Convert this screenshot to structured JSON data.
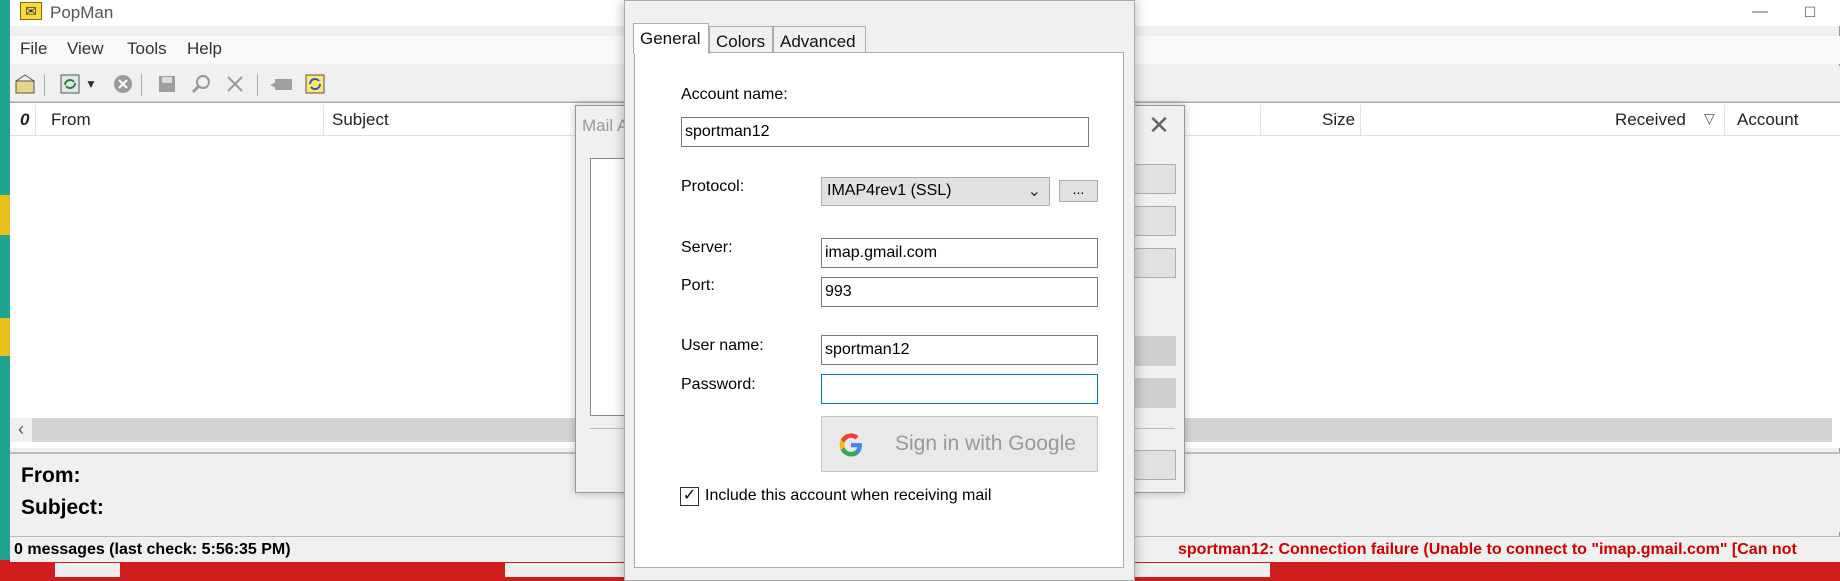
{
  "app": {
    "title": "PopMan",
    "icons": {
      "app": "envelope-icon",
      "minimize": "minimize-icon",
      "maximize": "maximize-icon"
    }
  },
  "menu": [
    "File",
    "View",
    "Tools",
    "Help"
  ],
  "toolbar": {
    "icons": [
      "mailbox-icon",
      "check-mail-icon",
      "dropdown-arrow-icon",
      "stop-icon",
      "save-icon",
      "find-icon",
      "delete-icon",
      "reply-icon",
      "sync-icon"
    ]
  },
  "list": {
    "columns": {
      "attachment": "0",
      "from": "From",
      "subject": "Subject",
      "size": "Size",
      "received": "Received",
      "account": "Account"
    }
  },
  "preview": {
    "from_label": "From:",
    "subject_label": "Subject:"
  },
  "status": {
    "count": "0 messages (last check: 5:56:35 PM)",
    "error": "sportman12:  Connection failure (Unable to connect to \"imap.gmail.com\" [Can not"
  },
  "mail_accounts_dialog": {
    "title_partial": "Mail A"
  },
  "account_dialog": {
    "tabs": [
      "General",
      "Colors",
      "Advanced"
    ],
    "active_tab": "General",
    "account_name_label": "Account name:",
    "account_name_value": "sportman12",
    "protocol_label": "Protocol:",
    "protocol_value": "IMAP4rev1 (SSL)",
    "protocol_more": "...",
    "server_label": "Server:",
    "server_value": "imap.gmail.com",
    "port_label": "Port:",
    "port_value": "993",
    "username_label": "User name:",
    "username_value": "sportman12",
    "password_label": "Password:",
    "password_value": "",
    "google_button": "Sign in with Google",
    "include_label": "Include this account when receiving mail",
    "include_checked": true
  }
}
